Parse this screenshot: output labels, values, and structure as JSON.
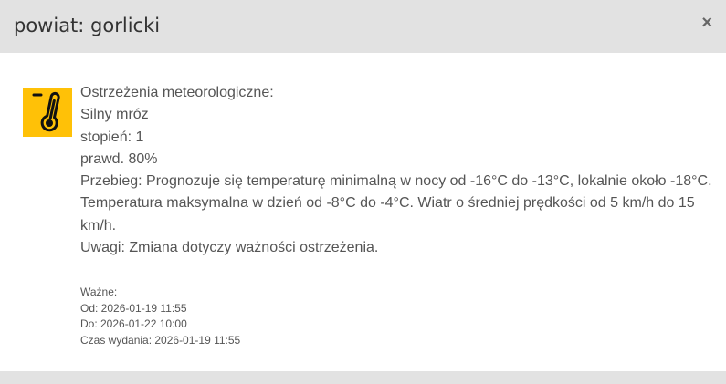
{
  "modal": {
    "title": "powiat: gorlicki",
    "close_label": "×"
  },
  "warning": {
    "icon": "thermometer-cold-icon",
    "icon_bg_color": "#ffc107",
    "heading": "Ostrzeżenia meteorologiczne:",
    "name": "Silny mróz",
    "degree": "stopień: 1",
    "probability": "prawd. 80%",
    "course_line1": "Przebieg: Prognozuje się temperaturę minimalną w nocy od -16°C do -13°C, lokalnie około -18°C.",
    "course_line2": "Temperatura maksymalna w dzień od -8°C do -4°C. Wiatr o średniej prędkości od 5 km/h do 15",
    "course_line3": "km/h.",
    "remarks": "Uwagi: Zmiana dotyczy ważności ostrzeżenia."
  },
  "validity": {
    "label": "Ważne:",
    "from": "Od: 2026-01-19 11:55",
    "to": "Do: 2026-01-22 10:00",
    "issued": "Czas wydania: 2026-01-19 11:55"
  }
}
